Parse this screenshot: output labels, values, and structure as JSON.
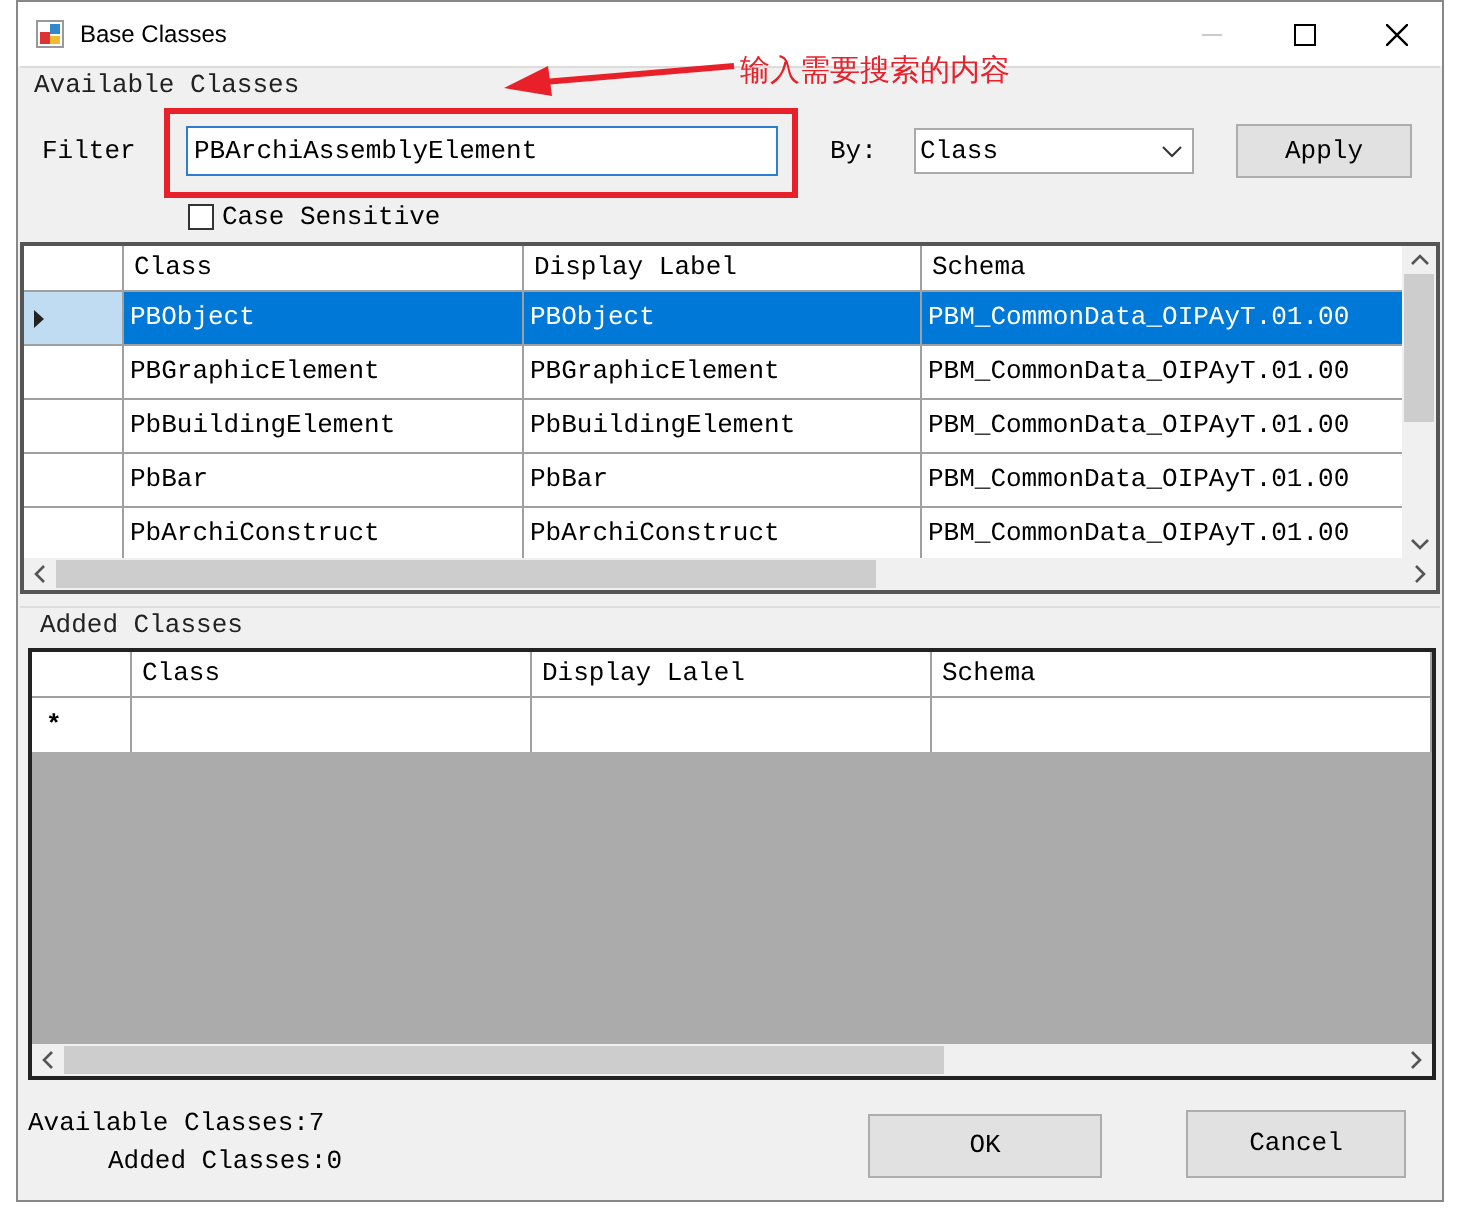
{
  "window": {
    "title": "Base Classes"
  },
  "available_classes": {
    "title": "Available Classes",
    "filter_label": "Filter",
    "filter": {
      "value": "PBArchiAssemblyElement"
    },
    "case_sensitive": {
      "label": "Case Sensitive",
      "checked": false
    },
    "by_label": "By:",
    "by": {
      "value": "Class"
    },
    "apply_button": "Apply",
    "table": {
      "columns": [
        "Class",
        "Display Label",
        "Schema"
      ],
      "rows": [
        {
          "cells": [
            "PBObject",
            "PBObject",
            "PBM_CommonData_OIPAyT.01.00"
          ],
          "selected": true
        },
        {
          "cells": [
            "PBGraphicElement",
            "PBGraphicElement",
            "PBM_CommonData_OIPAyT.01.00"
          ],
          "selected": false
        },
        {
          "cells": [
            "PbBuildingElement",
            "PbBuildingElement",
            "PBM_CommonData_OIPAyT.01.00"
          ],
          "selected": false
        },
        {
          "cells": [
            "PbBar",
            "PbBar",
            "PBM_CommonData_OIPAyT.01.00"
          ],
          "selected": false
        },
        {
          "cells": [
            "PbArchiConstruct",
            "PbArchiConstruct",
            "PBM_CommonData_OIPAyT.01.00"
          ],
          "selected": false
        }
      ]
    }
  },
  "annotation": {
    "text": "输入需要搜索的内容"
  },
  "added_classes": {
    "title": "Added Classes",
    "table": {
      "columns": [
        "Class",
        "Display Lalel",
        "Schema"
      ],
      "new_row_marker": "*"
    }
  },
  "status": [
    "Available Classes:7",
    "Added Classes:0"
  ],
  "buttons": [
    "OK",
    "Cancel"
  ]
}
